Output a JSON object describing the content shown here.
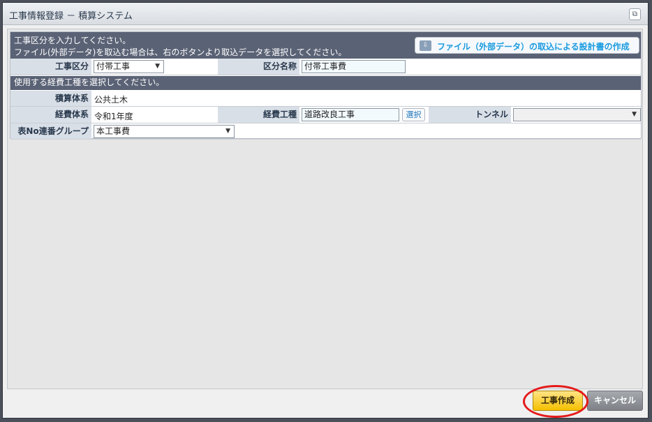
{
  "window": {
    "title": "工事情報登録 － 積算システム"
  },
  "header": {
    "line1": "工事区分を入力してください。",
    "line2": "ファイル(外部データ)を取込む場合は、右のボタンより取込データを選択してください。",
    "import_button": "ファイル（外部データ）の取込による設計書の作成"
  },
  "row_koji": {
    "label": "工事区分",
    "value": "付帯工事",
    "name_label": "区分名称",
    "name_value": "付帯工事費"
  },
  "section2": {
    "title": "使用する経費工種を選択してください。"
  },
  "row_sekisan": {
    "label": "積算体系",
    "value": "公共土木"
  },
  "row_keihi": {
    "label": "経費体系",
    "value": "令和1年度",
    "koshu_label": "経費工種",
    "koshu_value": "道路改良工事",
    "select_button": "選択",
    "tunnel_label": "トンネル",
    "tunnel_value": ""
  },
  "row_group": {
    "label": "表No連番グループ",
    "value": "本工事費"
  },
  "footer": {
    "create_button": "工事作成",
    "cancel_button": "キャンセル"
  },
  "colors": {
    "header_bg": "#5a6275",
    "label_bg": "#d9dfe7",
    "create_bg": "#f5c000",
    "cancel_bg": "#7e8187",
    "highlight_ring": "#e51a1a"
  },
  "icons": {
    "popout": "popout-icon",
    "import": "folder-import-icon",
    "dropdown": "dropdown-arrow-icon"
  }
}
